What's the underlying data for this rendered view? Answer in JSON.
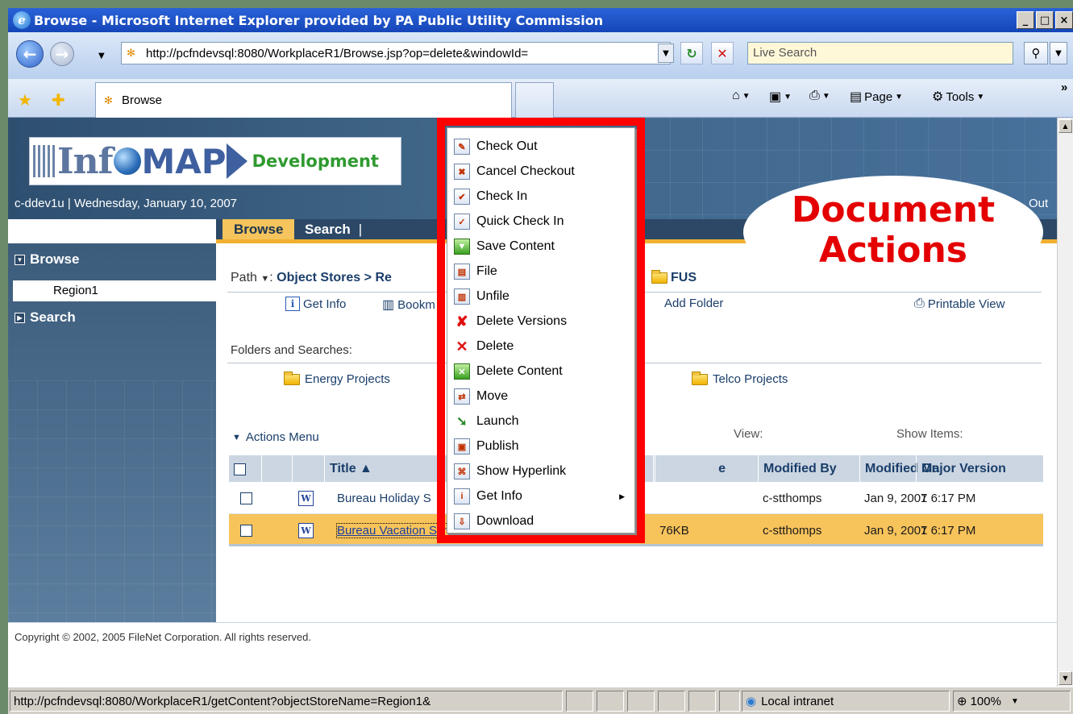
{
  "window": {
    "title": "Browse - Microsoft Internet Explorer provided by PA Public Utility Commission",
    "controls": [
      "_",
      "□",
      "×"
    ]
  },
  "address": {
    "url": "http://pcfndevsql:8080/WorkplaceR1/Browse.jsp?op=delete&windowId=",
    "search_placeholder": "Live Search"
  },
  "tabs": {
    "active_label": "Browse",
    "commands": {
      "page": "Page",
      "tools": "Tools"
    }
  },
  "banner": {
    "logo_inf": "Inf",
    "logo_map": "MAP",
    "logo_dev": "Development",
    "user_line": "c-ddev1u | Wednesday, January 10, 2007",
    "logout_fragment": "Out"
  },
  "nav_tabs": {
    "browse": "Browse",
    "search": "Search",
    "separator": "|"
  },
  "left_nav": {
    "browse_header": "Browse",
    "region_item": "Region1",
    "search_header": "Search"
  },
  "content": {
    "path_label": "Path",
    "path_object_stores": "Object Stores",
    "path_sep": ">",
    "path_fragment": "Re",
    "path_fus": "FUS",
    "get_info": "Get Info",
    "bookmark_fragment": "Bookm",
    "add_folder_fragment": "Add Folder",
    "printable_view": "Printable View",
    "folders_label": "Folders and Searches:",
    "folders": [
      "Energy Projects",
      "Telco Projects"
    ],
    "actions_menu": "Actions Menu",
    "view_label": "View:",
    "show_items_label": "Show Items:"
  },
  "table": {
    "headers": {
      "title": "Title ▲",
      "size_fragment": "e",
      "modified_by": "Modified By",
      "modified_on": "Modified On",
      "major_version": "Major Version"
    },
    "rows": [
      {
        "title": "Bureau Holiday S",
        "size": "",
        "modified_by": "c-stthomps",
        "modified_on": "Jan 9, 2007 6:17 PM",
        "major_version": "1"
      },
      {
        "title": "Bureau Vacation Schedule",
        "size": "76KB",
        "modified_by": "c-stthomps",
        "modified_on": "Jan 9, 2007 6:17 PM",
        "major_version": "1"
      }
    ]
  },
  "context_menu": {
    "items": [
      {
        "label": "Check Out",
        "icon": "check-out-icon"
      },
      {
        "label": "Cancel Checkout",
        "icon": "cancel-checkout-icon"
      },
      {
        "label": "Check In",
        "icon": "check-in-icon"
      },
      {
        "label": "Quick Check In",
        "icon": "quick-check-in-icon"
      },
      {
        "label": "Save Content",
        "icon": "save-content-icon"
      },
      {
        "label": "File",
        "icon": "file-icon"
      },
      {
        "label": "Unfile",
        "icon": "unfile-icon"
      },
      {
        "label": "Delete Versions",
        "icon": "delete-versions-icon"
      },
      {
        "label": "Delete",
        "icon": "delete-icon"
      },
      {
        "label": "Delete Content",
        "icon": "delete-content-icon"
      },
      {
        "label": "Move",
        "icon": "move-icon"
      },
      {
        "label": "Launch",
        "icon": "launch-icon"
      },
      {
        "label": "Publish",
        "icon": "publish-icon"
      },
      {
        "label": "Show Hyperlink",
        "icon": "hyperlink-icon"
      },
      {
        "label": "Get Info",
        "icon": "info-icon",
        "submenu": true
      },
      {
        "label": "Download",
        "icon": "download-icon"
      }
    ]
  },
  "callout": {
    "line1": "Document",
    "line2": "Actions"
  },
  "footer": {
    "copyright": "Copyright © 2002, 2005 FileNet Corporation. All rights reserved."
  },
  "status": {
    "url": "http://pcfndevsql:8080/WorkplaceR1/getContent?objectStoreName=Region1&",
    "zone": "Local intranet",
    "zoom": "100%"
  },
  "colors": {
    "title_blue": "#1546b8",
    "banner": "#3f6587",
    "tab_active": "#f6c45c",
    "row_selected": "#f7c35b",
    "callout_red": "#e40000"
  }
}
